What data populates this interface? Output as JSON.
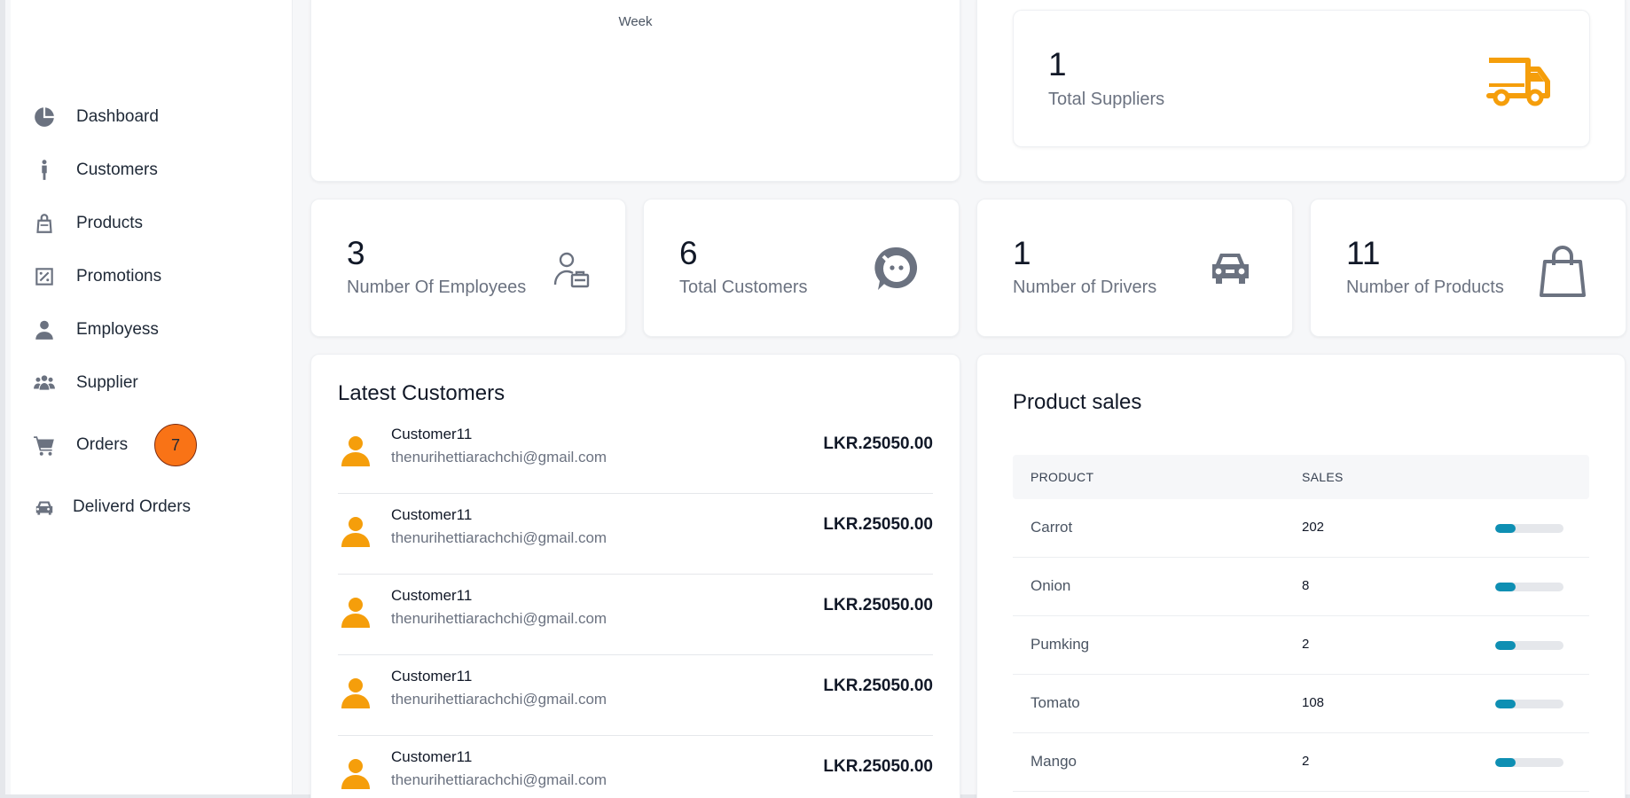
{
  "sidebar": {
    "items": [
      {
        "label": "Dashboard",
        "icon": "pie-chart-icon"
      },
      {
        "label": "Customers",
        "icon": "person-standing-icon"
      },
      {
        "label": "Products",
        "icon": "shopping-bag-icon"
      },
      {
        "label": "Promotions",
        "icon": "percent-tag-icon"
      },
      {
        "label": "Employess",
        "icon": "user-icon"
      },
      {
        "label": "Supplier",
        "icon": "users-group-icon"
      },
      {
        "label": "Orders",
        "icon": "cart-icon"
      },
      {
        "label": "Deliverd Orders",
        "icon": "car-icon"
      }
    ],
    "orders_badge": "7"
  },
  "chart_card": {
    "x_label": "Week"
  },
  "stats": {
    "suppliers": {
      "value": "1",
      "label": "Total Suppliers",
      "icon": "truck-icon",
      "color": "#f59e0b"
    },
    "employees": {
      "value": "3",
      "label": "Number Of Employees",
      "icon": "employee-badge-icon"
    },
    "customers": {
      "value": "6",
      "label": "Total Customers",
      "icon": "chat-bubble-icon"
    },
    "drivers": {
      "value": "1",
      "label": "Number of Drivers",
      "icon": "car-icon"
    },
    "products": {
      "value": "11",
      "label": "Number of Products",
      "icon": "shopping-bag-icon"
    }
  },
  "latest_customers": {
    "title": "Latest Customers",
    "rows": [
      {
        "name": "Customer11",
        "email": "thenurihettiarachchi@gmail.com",
        "amount": "LKR.25050.00"
      },
      {
        "name": "Customer11",
        "email": "thenurihettiarachchi@gmail.com",
        "amount": "LKR.25050.00"
      },
      {
        "name": "Customer11",
        "email": "thenurihettiarachchi@gmail.com",
        "amount": "LKR.25050.00"
      },
      {
        "name": "Customer11",
        "email": "thenurihettiarachchi@gmail.com",
        "amount": "LKR.25050.00"
      },
      {
        "name": "Customer11",
        "email": "thenurihettiarachchi@gmail.com",
        "amount": "LKR.25050.00"
      }
    ]
  },
  "product_sales": {
    "title": "Product sales",
    "headers": [
      "PRODUCT",
      "SALES"
    ],
    "bar_color": "#0e8fb3",
    "rows": [
      {
        "product": "Carrot",
        "sales": "202",
        "bar_fraction": 0.3
      },
      {
        "product": "Onion",
        "sales": "8",
        "bar_fraction": 0.3
      },
      {
        "product": "Pumking",
        "sales": "2",
        "bar_fraction": 0.3
      },
      {
        "product": "Tomato",
        "sales": "108",
        "bar_fraction": 0.3
      },
      {
        "product": "Mango",
        "sales": "2",
        "bar_fraction": 0.3
      }
    ]
  }
}
